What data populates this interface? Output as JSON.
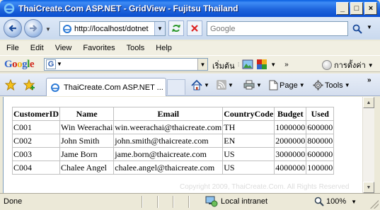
{
  "window": {
    "title": "ThaiCreate.Com ASP.NET - GridView - Fujitsu Thailand",
    "controls": [
      "_",
      "□",
      "×"
    ]
  },
  "address_bar": {
    "url": "http://localhost/dotnet",
    "search_placeholder": "Google"
  },
  "menu": [
    "File",
    "Edit",
    "View",
    "Favorites",
    "Tools",
    "Help"
  ],
  "google_toolbar": {
    "logo": "Google",
    "start_label": "เริ่มต้น",
    "settings_label": "การตั้งค่า"
  },
  "tabs": [
    {
      "label": "ThaiCreate.Com ASP.NET ..."
    }
  ],
  "commands": {
    "page": "Page",
    "tools": "Tools"
  },
  "grid": {
    "headers": [
      "CustomerID",
      "Name",
      "Email",
      "CountryCode",
      "Budget",
      "Used"
    ],
    "rows": [
      [
        "C001",
        "Win Weerachai",
        "win.weerachai@thaicreate.com",
        "TH",
        "1000000",
        "600000"
      ],
      [
        "C002",
        "John Smith",
        "john.smith@thaicreate.com",
        "EN",
        "2000000",
        "800000"
      ],
      [
        "C003",
        "Jame Born",
        "jame.born@thaicreate.com",
        "US",
        "3000000",
        "600000"
      ],
      [
        "C004",
        "Chalee Angel",
        "chalee.angel@thaicreate.com",
        "US",
        "4000000",
        "100000"
      ]
    ]
  },
  "watermark": "Copyright 2009, ThaiCreate.Com. All Rights Reserved",
  "status": {
    "text": "Done",
    "zone": "Local intranet",
    "zoom": "100%"
  },
  "colors": {
    "titlebar": "#1E64DC",
    "chrome": "#ECE9D8"
  }
}
